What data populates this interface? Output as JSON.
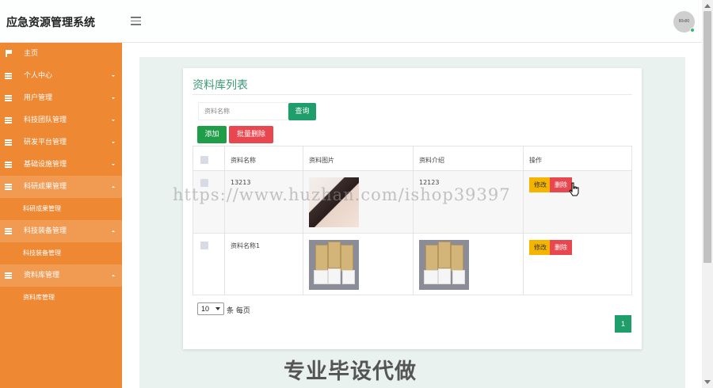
{
  "app": {
    "title": "应急资源管理系统"
  },
  "header": {
    "avatar_text": "80x80"
  },
  "sidebar": {
    "items": [
      {
        "label": "主页",
        "icon": "flag-icon"
      },
      {
        "label": "个人中心",
        "icon": "grid-icon"
      },
      {
        "label": "用户管理",
        "icon": "grid-icon"
      },
      {
        "label": "科技团队管理",
        "icon": "grid-icon"
      },
      {
        "label": "研发平台管理",
        "icon": "grid-icon"
      },
      {
        "label": "基础设施管理",
        "icon": "grid-icon"
      },
      {
        "label": "科研成果管理",
        "icon": "grid-icon",
        "expanded": true,
        "sub": "科研成果管理"
      },
      {
        "label": "科技装备管理",
        "icon": "grid-icon",
        "expanded": true,
        "sub": "科技装备管理"
      },
      {
        "label": "资料库管理",
        "icon": "grid-icon",
        "expanded": true,
        "sub": "资料库管理"
      }
    ]
  },
  "main": {
    "title": "资料库列表",
    "search_placeholder": "资料名称",
    "search_button": "查询",
    "add_button": "添加",
    "bulk_delete_button": "批量删除",
    "columns": [
      "资料名称",
      "资料图片",
      "资料介绍",
      "操作"
    ],
    "rows": [
      {
        "name": "13213",
        "image": "portrait-photo",
        "description": "12123",
        "edit": "修改",
        "delete": "删除"
      },
      {
        "name": "资料名称1",
        "image": "boxes-photo",
        "description_image": "boxes-photo",
        "edit": "修改",
        "delete": "删除"
      }
    ],
    "page_size": "10",
    "page_size_label": "条 每页",
    "current_page": "1"
  },
  "watermark": {
    "url": "https://www.huzhan.com/ishop39397",
    "text": "专业毕设代做"
  },
  "colors": {
    "sidebar": "#ef8833",
    "accent": "#1f9d6a",
    "danger": "#e8474f",
    "warning": "#f4b400"
  }
}
